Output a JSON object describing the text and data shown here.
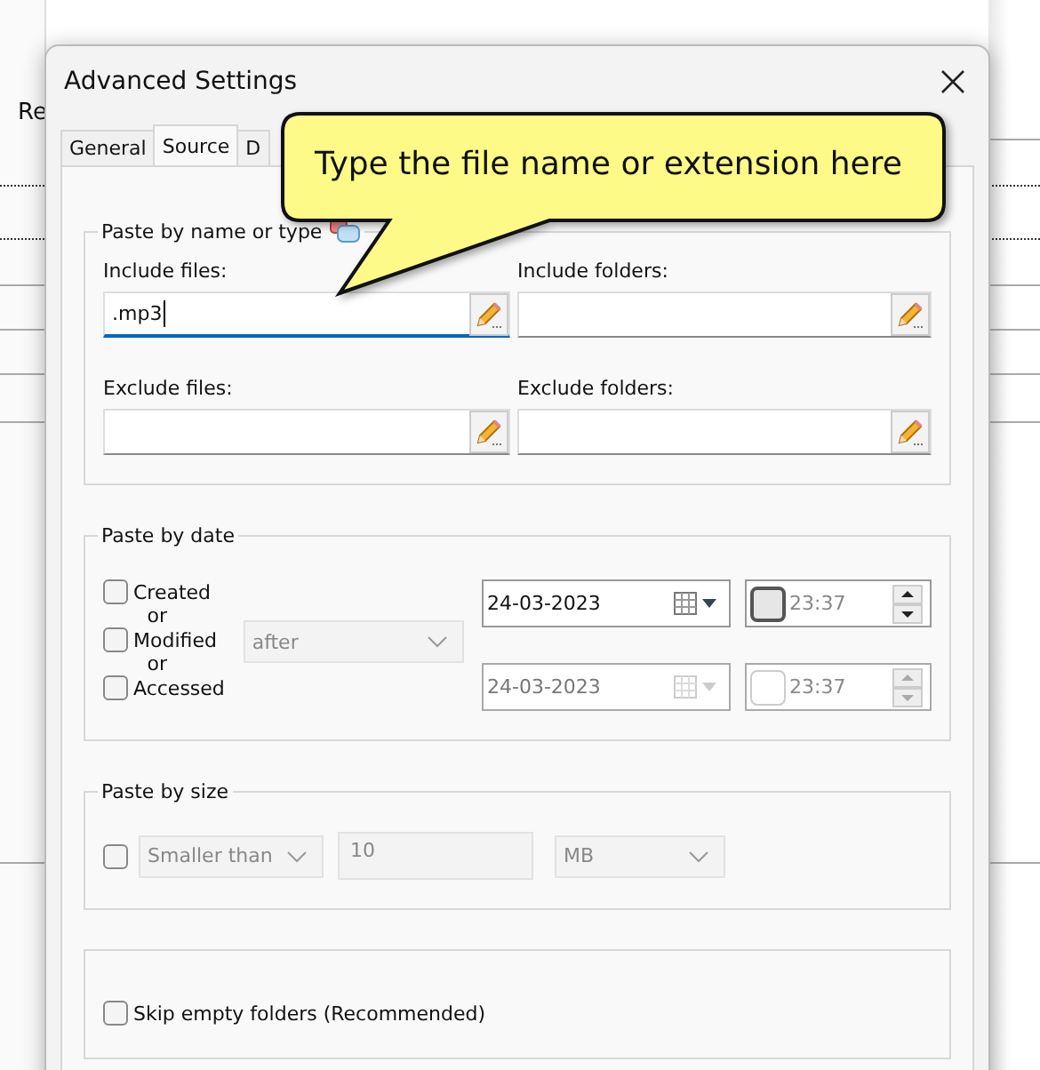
{
  "background_window": {
    "partial_label": "Re"
  },
  "dialog": {
    "title": "Advanced Settings"
  },
  "tabs": [
    {
      "label": "General",
      "selected": false
    },
    {
      "label": "Source",
      "selected": true
    },
    {
      "label": "D",
      "selected": false
    }
  ],
  "callout": {
    "text": "Type the file name or extension here"
  },
  "name_group": {
    "title": "Paste by name or type",
    "fields": [
      {
        "label": "Include files:",
        "value": ".mp3",
        "focused": true
      },
      {
        "label": "Include folders:",
        "focused": false
      },
      {
        "label": "Exclude files:",
        "focused": false
      },
      {
        "label": "Exclude folders:",
        "focused": false
      }
    ]
  },
  "date_group": {
    "title": "Paste by date",
    "checks": [
      {
        "label": "Created",
        "checked": false
      },
      {
        "label": "Modified",
        "checked": false
      },
      {
        "label": "Accessed",
        "checked": false
      }
    ],
    "connectors": [
      "or",
      "or"
    ],
    "mode": {
      "value": "after",
      "disabled": true
    },
    "dates": [
      {
        "date": "24-03-2023",
        "time": "23:37",
        "disabled": false,
        "checked": false
      },
      {
        "date": "24-03-2023",
        "time": "23:37",
        "disabled": true,
        "checked": false
      }
    ]
  },
  "size_group": {
    "title": "Paste by size",
    "checked": false,
    "disabled": true,
    "comparison": "Smaller than",
    "amount": "10",
    "unit": "MB"
  },
  "options": [
    {
      "label": "Skip empty folders (Recommended)",
      "checked": false
    }
  ]
}
